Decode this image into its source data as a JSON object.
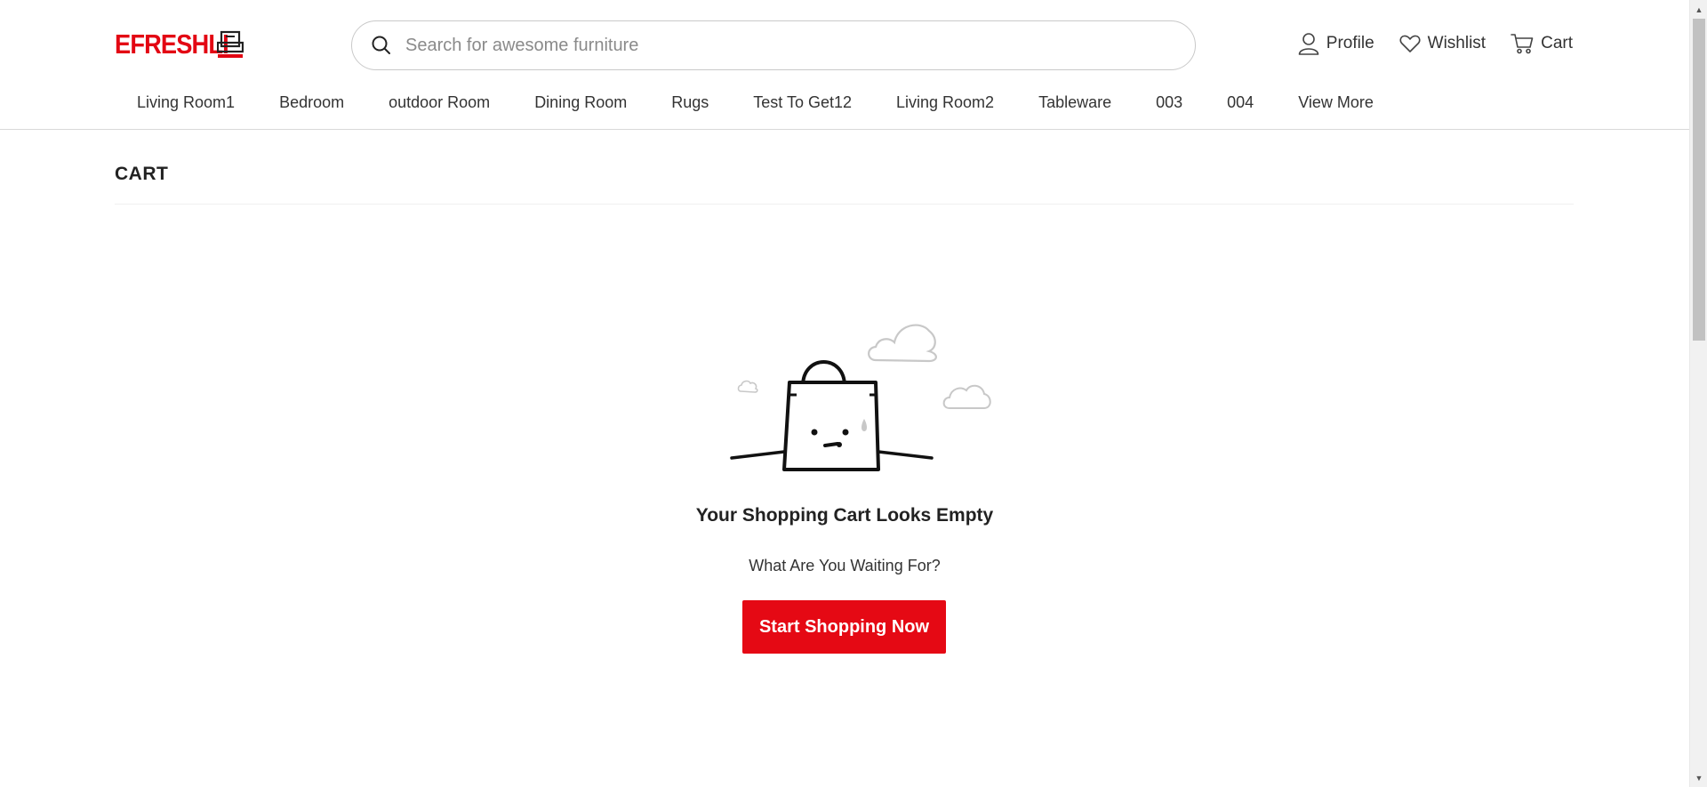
{
  "brand": {
    "name": "EFRESHLI",
    "color": "#e30613"
  },
  "search": {
    "placeholder": "Search for awesome furniture",
    "value": ""
  },
  "actions": [
    {
      "label": "Profile",
      "icon": "user-icon"
    },
    {
      "label": "Wishlist",
      "icon": "heart-icon"
    },
    {
      "label": "Cart",
      "icon": "cart-icon"
    }
  ],
  "nav": {
    "items": [
      "Living Room1",
      "Bedroom",
      "outdoor Room",
      "Dining Room",
      "Rugs",
      "Test To Get12",
      "Living Room2",
      "Tableware",
      "003",
      "004",
      "View More"
    ]
  },
  "page": {
    "title": "CART"
  },
  "empty_state": {
    "illustration": "sad-shopping-bag-illustration",
    "title": "Your Shopping Cart Looks Empty",
    "subtitle": "What Are You Waiting For?",
    "button": "Start Shopping Now",
    "button_color": "#e50914"
  }
}
